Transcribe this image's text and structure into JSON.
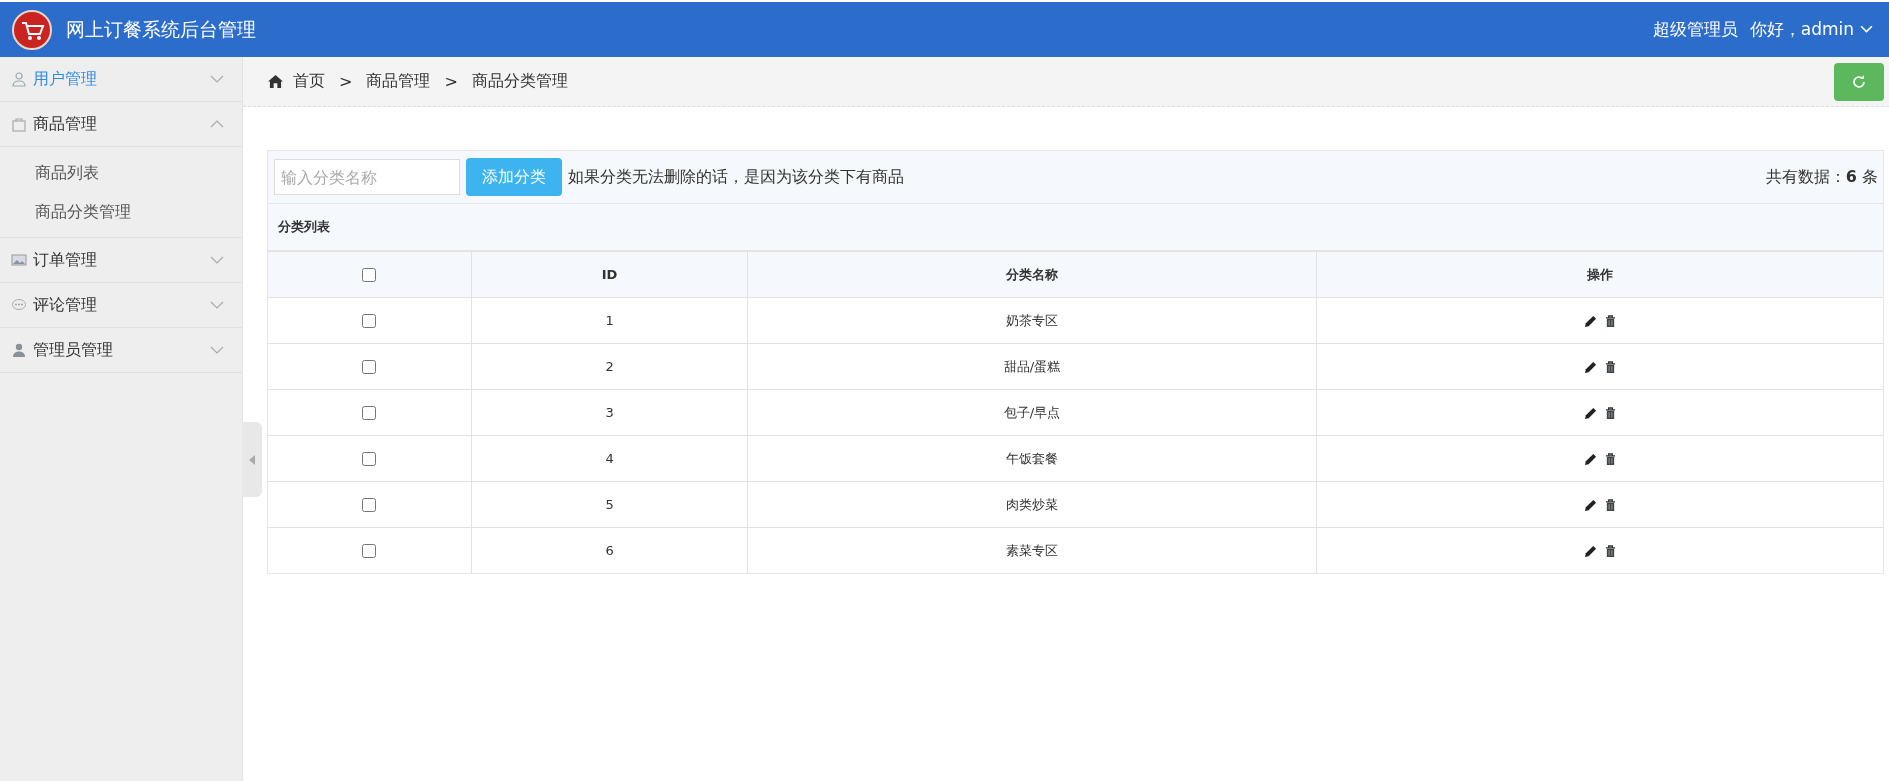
{
  "header": {
    "title": "网上订餐系统后台管理",
    "role": "超级管理员",
    "greeting": "你好，admin"
  },
  "sidebar": {
    "items": [
      {
        "label": "用户管理",
        "selected": true,
        "expanded": false
      },
      {
        "label": "商品管理",
        "selected": false,
        "expanded": true,
        "children": [
          {
            "label": "商品列表",
            "selected": false
          },
          {
            "label": "商品分类管理",
            "selected": false
          }
        ]
      },
      {
        "label": "订单管理",
        "selected": false,
        "expanded": false
      },
      {
        "label": "评论管理",
        "selected": false,
        "expanded": false
      },
      {
        "label": "管理员管理",
        "selected": false,
        "expanded": false
      }
    ]
  },
  "breadcrumb": [
    "首页",
    "商品管理",
    "商品分类管理"
  ],
  "breadcrumb_separator": ">",
  "toolbar": {
    "placeholder": "输入分类名称",
    "add_button": "添加分类",
    "note": "如果分类无法删除的话，是因为该分类下有商品",
    "total": "共有数据：**6** 条"
  },
  "table": {
    "title": "分类列表",
    "header_checked": false,
    "columns": [
      "ID",
      "分类名称",
      "操作"
    ],
    "rows": [
      {
        "id": "1",
        "name": "奶茶专区",
        "checked": false
      },
      {
        "id": "2",
        "name": "甜品/蛋糕",
        "checked": false
      },
      {
        "id": "3",
        "name": "包子/早点",
        "checked": false
      },
      {
        "id": "4",
        "name": "午饭套餐",
        "checked": false
      },
      {
        "id": "5",
        "name": "肉类炒菜",
        "checked": false
      },
      {
        "id": "6",
        "name": "素菜专区",
        "checked": false
      }
    ]
  }
}
